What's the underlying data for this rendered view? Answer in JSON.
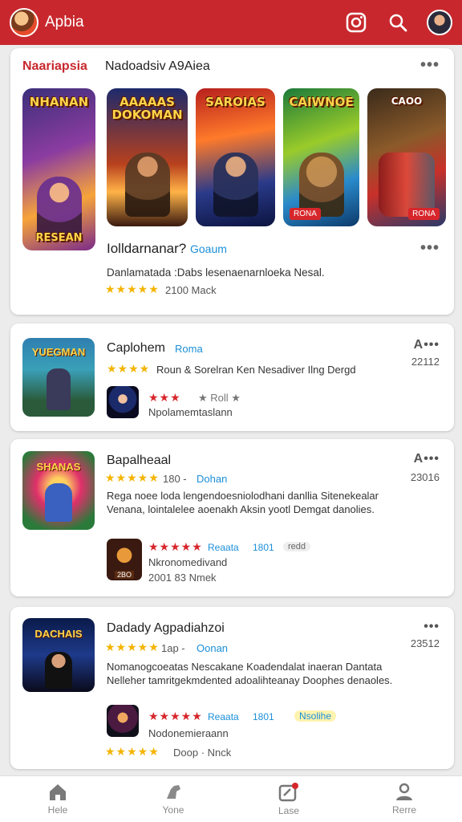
{
  "header": {
    "app_name": "Apbia",
    "instagram_icon": "instagram-icon",
    "search_icon": "search-icon",
    "profile_icon": "avatar"
  },
  "featured": {
    "section_title": "Naariapsia",
    "section_subtitle": "Nadoadsiv A9Aiea",
    "more": "•••",
    "games": [
      {
        "title": "NHANAN",
        "subtitle": "RESEAN",
        "tag": ""
      },
      {
        "title": "AAAAAS DOKOMAN",
        "tag": ""
      },
      {
        "title": "SAROIAS",
        "tag": ""
      },
      {
        "title": "CAIWNOE",
        "tag": "RONA"
      },
      {
        "title": "CAOO",
        "tag": "RONA"
      }
    ],
    "name": "Iolldarnanar?",
    "badge": "Goaum",
    "description": "Danlamatada :Dabs lesenaenarnloeka Nesal.",
    "stars": "★★★★★",
    "meta": "2100 Mack"
  },
  "list": [
    {
      "thumb_title": "YUEGMAN",
      "name": "Caplohem",
      "badge": "Roma",
      "stars": "★★★★",
      "desc": "Roun & Sorelran Ken Nesadiver Ilng Dergd",
      "count": "22112",
      "more": "A•••",
      "sub_stars": "★★★",
      "sub_rating": "★ Roll ★",
      "sub_text": "Npolamemtaslann"
    },
    {
      "thumb_title": "SHANAS",
      "name": "Bapalheaal",
      "stars": "★★★★★",
      "rating": "180 -",
      "badge": "Dohan",
      "desc": "Rega noee loda lengendoesniolodhani danllia Sitenekealar Venana, lointalelee aoenakh Aksin yootl Demgat danolies.",
      "count": "23016",
      "more": "A•••",
      "sub_stars": "★★★★★",
      "sub_badge": "Reaata",
      "sub_rating": "1801",
      "sub_extra": "redd",
      "sub_text": "Nkronomedivand",
      "sub_meta": "2001 83 Nmek",
      "mini_tag": "2BO"
    },
    {
      "thumb_title": "DACHAIS",
      "name": "Dadady Agpadiahzoi",
      "stars": "★★★★★",
      "rating": "1ap -",
      "badge": "Oonan",
      "desc": "Nomanogcoeatas Nescakane Koadendalat inaeran Dantata Nelleher tamritgekmdented adoalihteanay Doophes denaoles.",
      "count": "23512",
      "more": "•••",
      "sub_stars": "★★★★★",
      "sub_badge": "Reaata",
      "sub_rating": "1801",
      "sub_extra": "Nsolihe",
      "sub_text": "Nodonemieraann",
      "sub_meta": "Doop · Nnck",
      "bottom_stars": "★★★★★"
    }
  ],
  "bottom_nav": [
    {
      "label": "Hele",
      "icon": "home-icon"
    },
    {
      "label": "Yone",
      "icon": "gamepad-icon"
    },
    {
      "label": "Lase",
      "icon": "library-icon"
    },
    {
      "label": "Rerre",
      "icon": "profile-icon"
    }
  ],
  "colors": {
    "brand": "#c8282d",
    "link": "#1b8fd8",
    "star": "#f4b400",
    "red_star": "#d7262b"
  }
}
